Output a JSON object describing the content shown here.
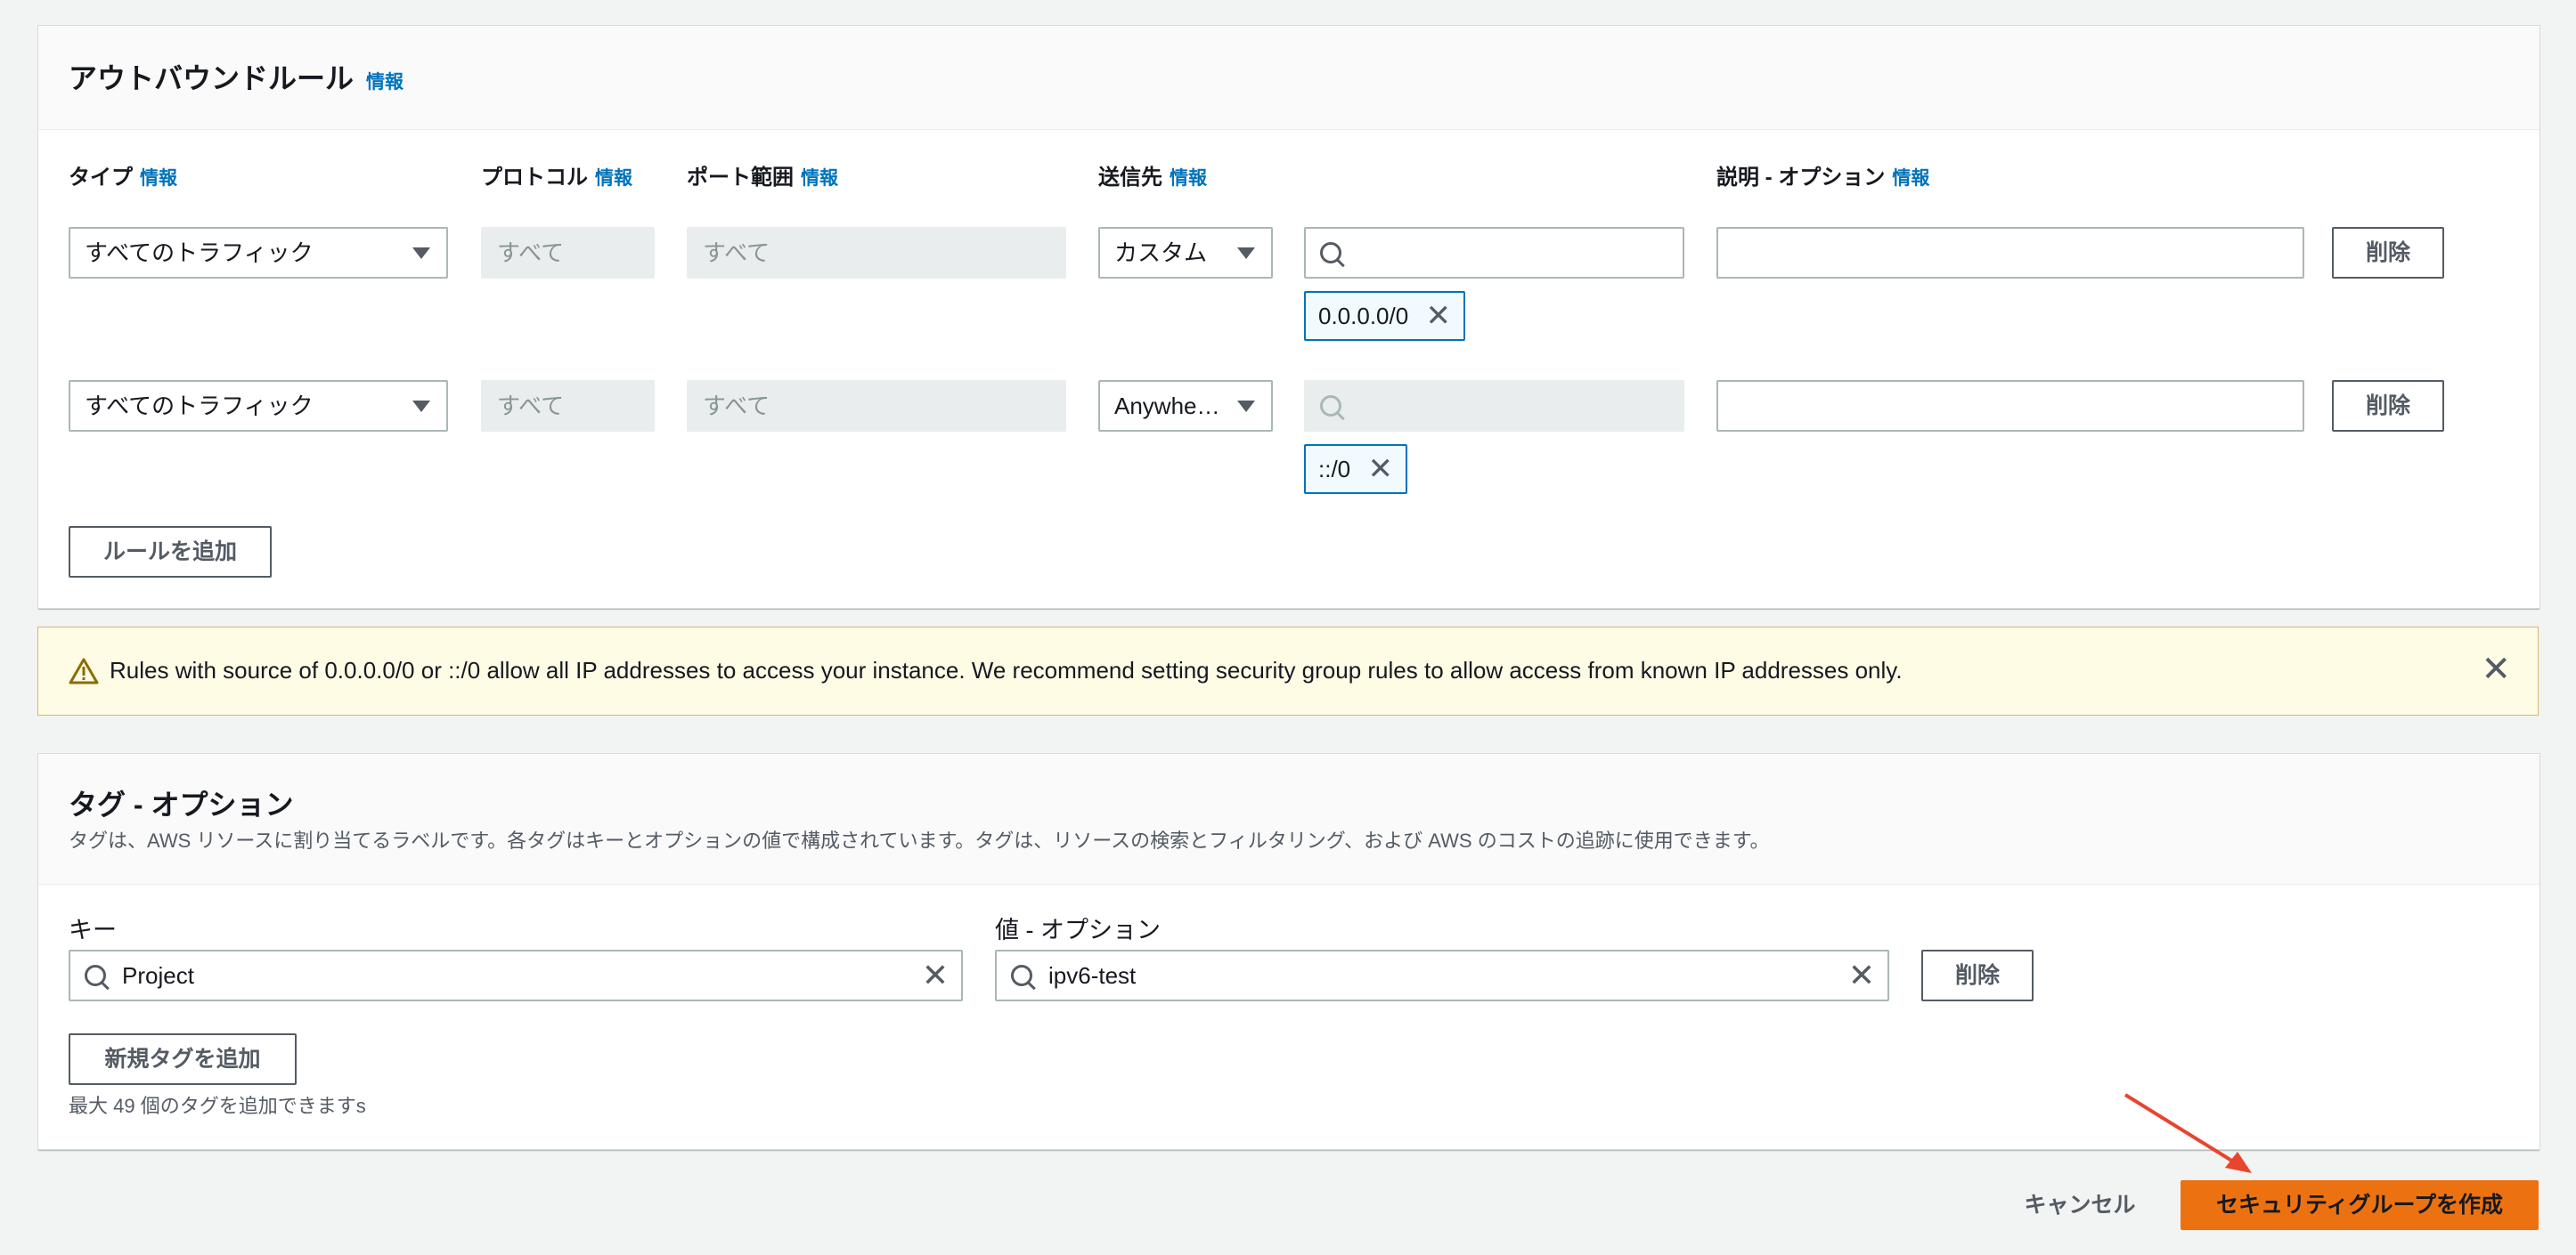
{
  "outbound": {
    "title": "アウトバウンドルール",
    "info": "情報",
    "columns": {
      "type": "タイプ",
      "protocol": "プロトコル",
      "port_range": "ポート範囲",
      "destination": "送信先",
      "description": "説明 - オプション"
    },
    "rules": [
      {
        "type": "すべてのトラフィック",
        "protocol": "すべて",
        "port_range": "すべて",
        "destination_type": "カスタム",
        "cidr_chip": "0.0.0.0/0",
        "description": "",
        "delete_label": "削除"
      },
      {
        "type": "すべてのトラフィック",
        "protocol": "すべて",
        "port_range": "すべて",
        "destination_type": "Anywhe…",
        "cidr_chip": "::/0",
        "description": "",
        "delete_label": "削除"
      }
    ],
    "add_rule_label": "ルールを追加"
  },
  "alert": {
    "message": "Rules with source of 0.0.0.0/0 or ::/0 allow all IP addresses to access your instance. We recommend setting security group rules to allow access from known IP addresses only."
  },
  "tags": {
    "title": "タグ - オプション",
    "description": "タグは、AWS リソースに割り当てるラベルです。各タグはキーとオプションの値で構成されています。タグは、リソースの検索とフィルタリング、および AWS のコストの追跡に使用できます。",
    "key_label": "キー",
    "value_label": "値 - オプション",
    "key_value": "Project",
    "value_value": "ipv6-test",
    "delete_label": "削除",
    "add_tag_label": "新規タグを追加",
    "limit_text": "最大 49 個のタグを追加できますs"
  },
  "footer": {
    "cancel_label": "キャンセル",
    "create_label": "セキュリティグループを作成"
  },
  "colors": {
    "primary": "#ec7211",
    "link": "#0073bb",
    "annotation_arrow": "#e8452c"
  }
}
